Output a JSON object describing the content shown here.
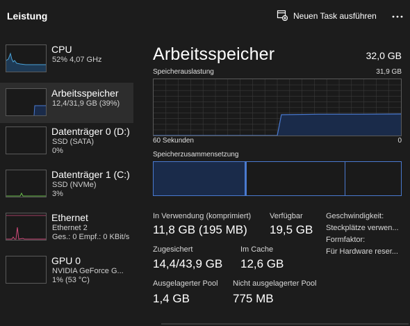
{
  "header": {
    "title": "Leistung",
    "new_task_label": "Neuen Task ausführen"
  },
  "sidebar": {
    "items": [
      {
        "name": "CPU",
        "sub1": "52%  4,07 GHz",
        "sub2": "",
        "color": "#4aa3d8",
        "selected": false
      },
      {
        "name": "Arbeitsspeicher",
        "sub1": "12,4/31,9 GB (39%)",
        "sub2": "",
        "color": "#4a7ad0",
        "selected": true
      },
      {
        "name": "Datenträger 0 (D:)",
        "sub1": "SSD (SATA)",
        "sub2": "0%",
        "color": "#6abf4b",
        "selected": false
      },
      {
        "name": "Datenträger 1 (C:)",
        "sub1": "SSD (NVMe)",
        "sub2": "3%",
        "color": "#6abf4b",
        "selected": false
      },
      {
        "name": "Ethernet",
        "sub1": "Ethernet 2",
        "sub2": "Ges.: 0 Empf.: 0 KBit/s",
        "color": "#d04a7a",
        "selected": false
      },
      {
        "name": "GPU 0",
        "sub1": "NVIDIA GeForce G...",
        "sub2": "1%  (53 °C)",
        "color": "#4aa3d8",
        "selected": false
      }
    ]
  },
  "main": {
    "title": "Arbeitsspeicher",
    "total": "32,0 GB",
    "usage_label": "Speicherauslastung",
    "usage_max": "31,9 GB",
    "time_label": "60 Sekunden",
    "time_min": "0",
    "composition_label": "Speicherzusammensetzung",
    "stats": {
      "in_use_label": "In Verwendung (komprimiert)",
      "in_use_value": "11,8 GB (195 MB)",
      "available_label": "Verfügbar",
      "available_value": "19,5 GB",
      "committed_label": "Zugesichert",
      "committed_value": "14,4/43,9 GB",
      "cached_label": "Im Cache",
      "cached_value": "12,6 GB",
      "paged_label": "Ausgelagerter Pool",
      "paged_value": "1,4 GB",
      "nonpaged_label": "Nicht ausgelagerter Pool",
      "nonpaged_value": "775 MB"
    },
    "specs": {
      "speed": "Geschwindigkeit:",
      "slots": "Steckplätze verwen...",
      "form": "Formfaktor:",
      "reserved": "Für Hardware reser..."
    }
  },
  "usage_chart": {
    "type": "area",
    "ylim": [
      0,
      31.9
    ],
    "x": [
      60,
      48,
      38,
      30,
      29,
      20,
      10,
      0
    ],
    "y": [
      0,
      0,
      0,
      0,
      11.8,
      12.1,
      12.1,
      12.2
    ]
  },
  "composition": {
    "in_use_fraction": 0.37,
    "modified_fraction": 0.005,
    "standby_fraction": 0.4,
    "free_fraction": 0.225
  },
  "colors": {
    "accent": "#4a7ad0",
    "fill": "#1a2b4a",
    "grid": "#3a3a3a"
  }
}
